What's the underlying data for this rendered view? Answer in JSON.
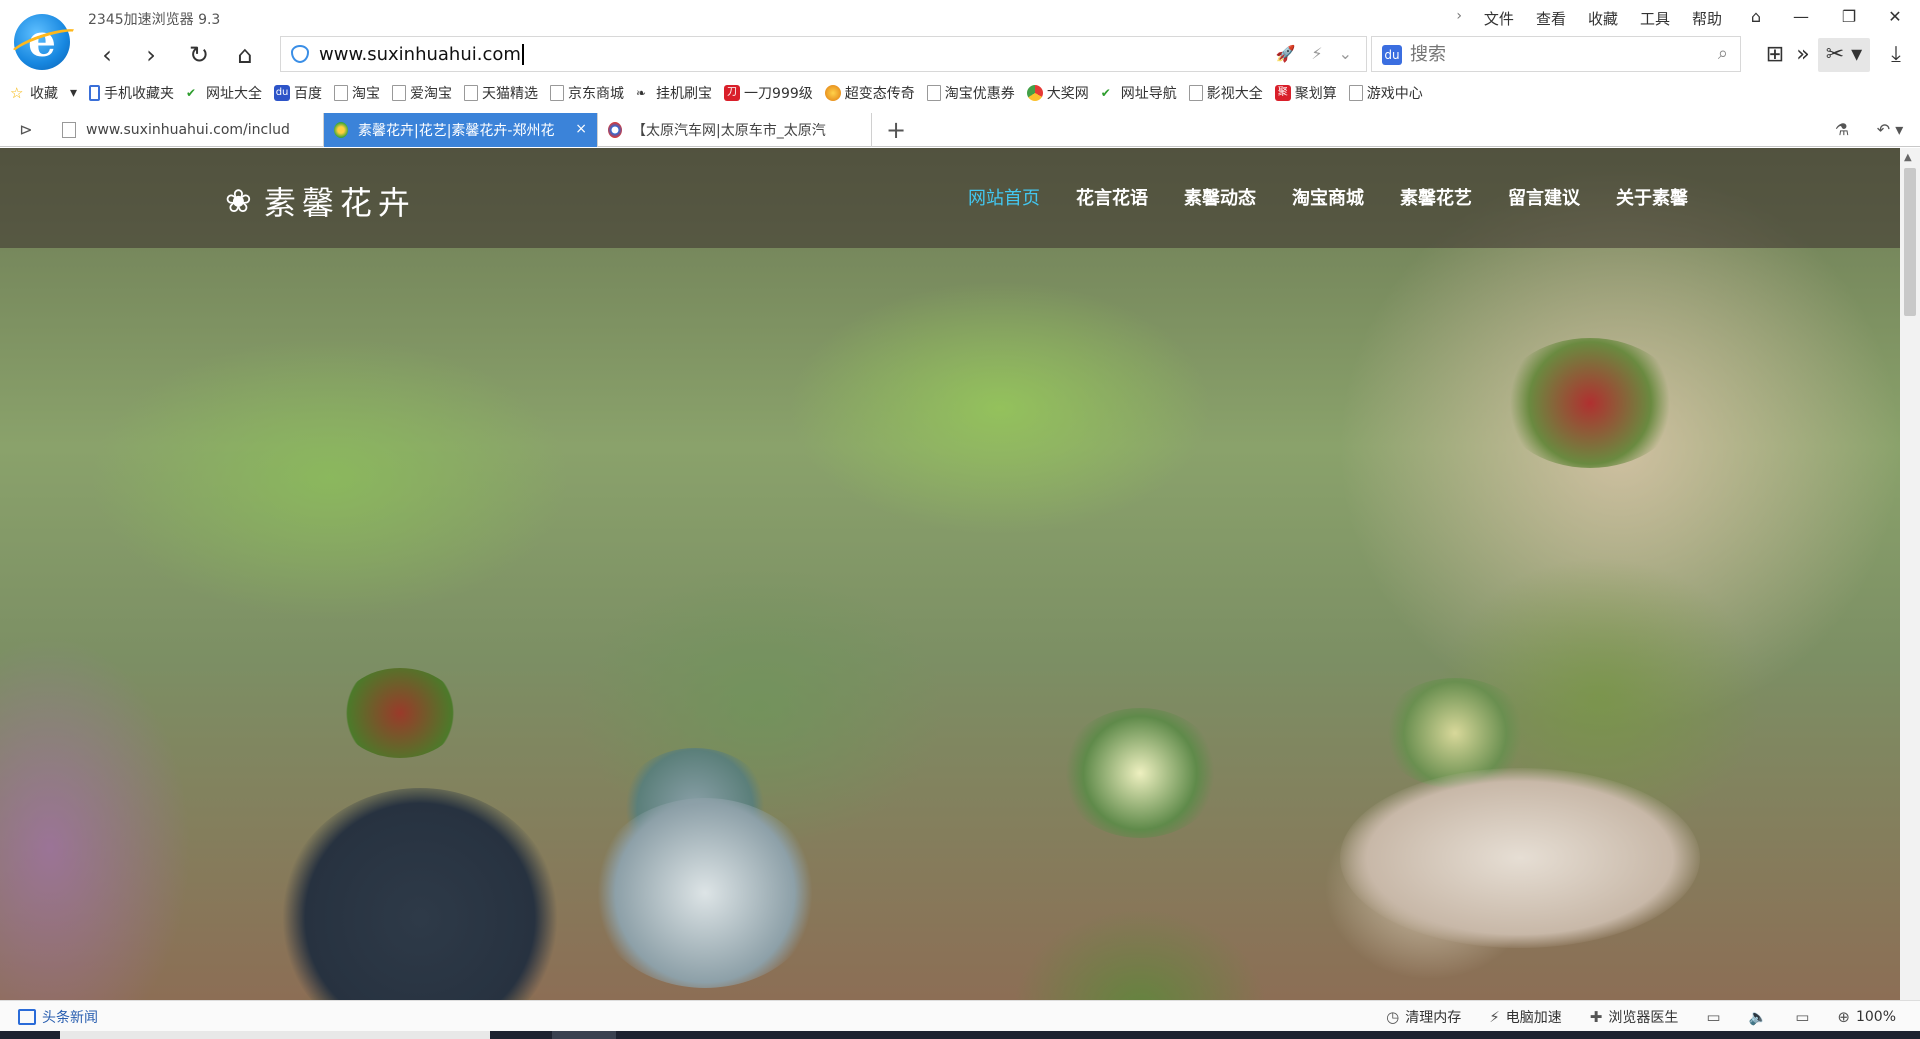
{
  "browser": {
    "app_title": "2345加速浏览器 9.3",
    "menu": [
      "文件",
      "查看",
      "收藏",
      "工具",
      "帮助"
    ],
    "menu_chevron": "›",
    "window_controls": {
      "skin": "⌂",
      "minimize": "—",
      "maximize": "❐",
      "close": "✕"
    }
  },
  "nav": {
    "back": "‹",
    "forward": "›",
    "reload": "↻",
    "home": "⌂",
    "url": "www.suxinhuahui.com",
    "search_placeholder": "搜索",
    "search_icon": "⌕",
    "addr_icons": [
      "🚀",
      "⚡",
      "⌄"
    ],
    "tools": {
      "apps": "⊞",
      "more": "»",
      "cut": "✂ ▾",
      "download": "⤓"
    }
  },
  "bookmarks": [
    {
      "label": "收藏",
      "icon": "fav",
      "glyph": "☆"
    },
    {
      "label": "▾",
      "icon": "none",
      "glyph": ""
    },
    {
      "label": "手机收藏夹",
      "icon": "phone",
      "glyph": ""
    },
    {
      "label": "网址大全",
      "icon": "hao",
      "glyph": "✔"
    },
    {
      "label": "百度",
      "icon": "baidu",
      "glyph": "du"
    },
    {
      "label": "淘宝",
      "icon": "page",
      "glyph": ""
    },
    {
      "label": "爱淘宝",
      "icon": "page",
      "glyph": ""
    },
    {
      "label": "天猫精选",
      "icon": "page",
      "glyph": ""
    },
    {
      "label": "京东商城",
      "icon": "page",
      "glyph": ""
    },
    {
      "label": "挂机刷宝",
      "icon": "hook",
      "glyph": "❧"
    },
    {
      "label": "一刀999级",
      "icon": "red",
      "glyph": "刀"
    },
    {
      "label": "超变态传奇",
      "icon": "round",
      "glyph": ""
    },
    {
      "label": "淘宝优惠券",
      "icon": "page",
      "glyph": ""
    },
    {
      "label": "大奖网",
      "icon": "chrome",
      "glyph": ""
    },
    {
      "label": "网址导航",
      "icon": "hao",
      "glyph": "✔"
    },
    {
      "label": "影视大全",
      "icon": "page",
      "glyph": ""
    },
    {
      "label": "聚划算",
      "icon": "red",
      "glyph": "聚"
    },
    {
      "label": "游戏中心",
      "icon": "page",
      "glyph": ""
    }
  ],
  "tabs": {
    "sidebar_toggle": "⊳",
    "items": [
      {
        "label": "www.suxinhuahui.com/includ",
        "active": false
      },
      {
        "label": "素馨花卉|花艺|素馨花卉-郑州花",
        "active": true,
        "close": "×"
      },
      {
        "label": "【太原汽车网|太原车市_太原汽",
        "active": false
      }
    ],
    "new_tab": "+",
    "right_icons": [
      "⚗",
      "↶ ▾"
    ]
  },
  "site": {
    "logo_mark": "❀",
    "name": "素馨花卉",
    "nav": [
      "网站首页",
      "花言花语",
      "素馨动态",
      "淘宝商城",
      "素馨花艺",
      "留言建议",
      "关于素馨"
    ],
    "active_nav_index": 0
  },
  "scrollbar": {
    "up_arrow": "▲"
  },
  "status": {
    "news": "头条新闻",
    "items": [
      {
        "label": "清理内存",
        "icon": "◷"
      },
      {
        "label": "电脑加速",
        "icon": "⚡"
      },
      {
        "label": "浏览器医生",
        "icon": "✚"
      },
      {
        "label": "",
        "icon": "▭"
      },
      {
        "label": "",
        "icon": "🔈"
      },
      {
        "label": "",
        "icon": "▭"
      },
      {
        "label": "100%",
        "icon": "⊕"
      }
    ]
  },
  "colors": {
    "tab_active_bg": "#3b83d9",
    "site_nav_active": "#43c7f0",
    "site_header_overlay": "rgba(60,50,45,0.55)"
  }
}
